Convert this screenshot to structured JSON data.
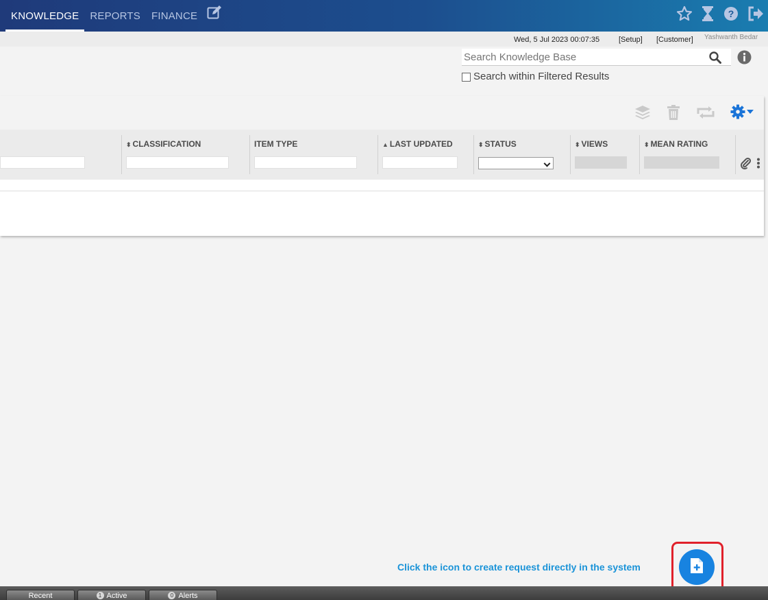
{
  "nav": {
    "tabs": [
      {
        "label": "KNOWLEDGE",
        "active": true
      },
      {
        "label": "REPORTS",
        "active": false
      },
      {
        "label": "FINANCE",
        "active": false
      }
    ],
    "icons": [
      "edit-icon",
      "favorite-star-icon",
      "hourglass-icon",
      "help-icon",
      "logout-icon"
    ]
  },
  "info": {
    "date": "Wed, 5 Jul 2023 00:07:35",
    "setup": "[Setup]",
    "customer": "[Customer]",
    "user": "Yashwanth Bedar"
  },
  "search": {
    "placeholder": "Search Knowledge Base",
    "filter_label": "Search within Filtered Results",
    "filter_checked": false
  },
  "table": {
    "columns": [
      {
        "label": "CLASSIFICATION",
        "sortable": true
      },
      {
        "label": "ITEM TYPE",
        "sortable": false
      },
      {
        "label": "LAST UPDATED",
        "sortable": true
      },
      {
        "label": "STATUS",
        "sortable": true
      },
      {
        "label": "VIEWS",
        "sortable": true
      },
      {
        "label": "MEAN RATING",
        "sortable": true
      }
    ],
    "rows": []
  },
  "promo": {
    "text": "Click the icon to create request directly in the system"
  },
  "bottom": {
    "recent": "Recent",
    "active_count": "1",
    "active": "Active",
    "alerts_count": "0",
    "alerts": "Alerts"
  },
  "colors": {
    "accent": "#1883e0",
    "highlight": "#e0202a",
    "promo_text": "#1a93d8"
  }
}
